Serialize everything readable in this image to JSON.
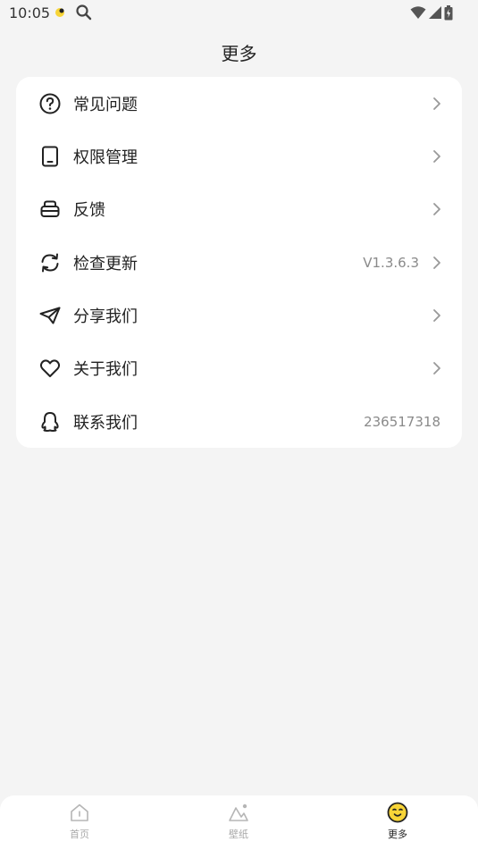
{
  "status_bar": {
    "time": "10:05"
  },
  "header": {
    "title": "更多"
  },
  "menu": {
    "items": [
      {
        "label": "常见问题",
        "value": "",
        "icon": "help-circle-icon"
      },
      {
        "label": "权限管理",
        "value": "",
        "icon": "phone-icon"
      },
      {
        "label": "反馈",
        "value": "",
        "icon": "feedback-icon"
      },
      {
        "label": "检查更新",
        "value": "V1.3.6.3",
        "icon": "refresh-icon"
      },
      {
        "label": "分享我们",
        "value": "",
        "icon": "paper-plane-icon"
      },
      {
        "label": "关于我们",
        "value": "",
        "icon": "heart-icon"
      },
      {
        "label": "联系我们",
        "value": "236517318",
        "icon": "qq-icon"
      }
    ]
  },
  "bottom_nav": {
    "items": [
      {
        "label": "首页",
        "icon": "home-icon",
        "active": false
      },
      {
        "label": "壁纸",
        "icon": "wallpaper-icon",
        "active": false
      },
      {
        "label": "更多",
        "icon": "more-face-icon",
        "active": true
      }
    ]
  },
  "colors": {
    "accent": "#f7d437",
    "background": "#f4f4f4",
    "card": "#ffffff",
    "muted": "#8a8a8a"
  }
}
